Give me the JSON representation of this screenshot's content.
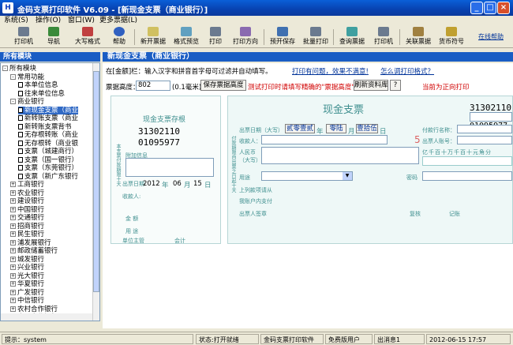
{
  "window": {
    "title": "金码支票打印软件  V6.09  - [新现金支票（商业银行）]",
    "min": "_",
    "max": "□",
    "close": "×"
  },
  "menu": [
    "系统(S)",
    "操作(O)",
    "窗口(W)",
    "更多票据(L)"
  ],
  "toolbar": [
    "打印机",
    "导航",
    "大写格式",
    "帮助",
    "新开票据",
    "格式预览",
    "打印",
    "打印方向",
    "预开保存",
    "批量打印",
    "查询票据",
    "打印机",
    "关联票据",
    "货币符号"
  ],
  "toolbar_link": "在线帮助",
  "sidebar": {
    "header": "所有模块",
    "tree": [
      {
        "t": "所有模块",
        "lv": 0,
        "k": "box",
        "s": "-"
      },
      {
        "t": "常用功能",
        "lv": 1,
        "k": "box",
        "s": "-"
      },
      {
        "t": "本单位信息",
        "lv": 2,
        "k": "pg"
      },
      {
        "t": "往来单位信息",
        "lv": 2,
        "k": "pg"
      },
      {
        "t": "商业银行",
        "lv": 1,
        "k": "box",
        "s": "-"
      },
      {
        "t": "新现金支票（商业",
        "lv": 2,
        "k": "pg",
        "sel": true
      },
      {
        "t": "新转账支票（商业",
        "lv": 2,
        "k": "pg"
      },
      {
        "t": "新转账支票背书",
        "lv": 2,
        "k": "pg"
      },
      {
        "t": "无存根转账（商业",
        "lv": 2,
        "k": "pg"
      },
      {
        "t": "无存根转（商业银",
        "lv": 2,
        "k": "pg"
      },
      {
        "t": "支票（城建商行）",
        "lv": 2,
        "k": "pg"
      },
      {
        "t": "支票（国一银行）",
        "lv": 2,
        "k": "pg"
      },
      {
        "t": "支票（东莞银行）",
        "lv": 2,
        "k": "pg"
      },
      {
        "t": "支票（新广东银行",
        "lv": 2,
        "k": "pg"
      },
      {
        "t": "工商银行",
        "lv": 1,
        "k": "box",
        "s": "+"
      },
      {
        "t": "农业银行",
        "lv": 1,
        "k": "box",
        "s": "+"
      },
      {
        "t": "建设银行",
        "lv": 1,
        "k": "box",
        "s": "+"
      },
      {
        "t": "中国银行",
        "lv": 1,
        "k": "box",
        "s": "+"
      },
      {
        "t": "交通银行",
        "lv": 1,
        "k": "box",
        "s": "+"
      },
      {
        "t": "招商银行",
        "lv": 1,
        "k": "box",
        "s": "+"
      },
      {
        "t": "民生银行",
        "lv": 1,
        "k": "box",
        "s": "+"
      },
      {
        "t": "浦发展银行",
        "lv": 1,
        "k": "box",
        "s": "+"
      },
      {
        "t": "邮政储蓄银行",
        "lv": 1,
        "k": "box",
        "s": "+"
      },
      {
        "t": "城发银行",
        "lv": 1,
        "k": "box",
        "s": "+"
      },
      {
        "t": "兴业银行",
        "lv": 1,
        "k": "box",
        "s": "+"
      },
      {
        "t": "光大银行",
        "lv": 1,
        "k": "box",
        "s": "+"
      },
      {
        "t": "华夏银行",
        "lv": 1,
        "k": "box",
        "s": "+"
      },
      {
        "t": "广发银行",
        "lv": 1,
        "k": "box",
        "s": "+"
      },
      {
        "t": "中信银行",
        "lv": 1,
        "k": "box",
        "s": "+"
      },
      {
        "t": "农村合作银行",
        "lv": 1,
        "k": "box",
        "s": "+"
      },
      {
        "t": "广州商业银行",
        "lv": 1,
        "k": "box",
        "s": "+"
      }
    ]
  },
  "main": {
    "header": "新现金支票（商业银行）",
    "hint": "在[金额]栏：输入汉字和拼音首字母可过滤并自动填写。",
    "link1": "打印有问题，效果不满意!",
    "link2": "怎么调打印格式？",
    "height_label": "票据高度：",
    "height_value": "802",
    "unit": "(0.1毫米)",
    "save_btn": "保存票据高度",
    "warn": "测试打印时请填写精确的\"票据高度\"！",
    "refresh_btn": "刷新资料库",
    "q_btn": "?",
    "right_note": "当前为正向打印"
  },
  "stub": {
    "title": "现金支票存根",
    "code1": "31302110",
    "code2": "01095977",
    "extra": "附加信息",
    "date_label": "出票日期",
    "year": "2012",
    "month": "06",
    "day": "15",
    "y": "年",
    "m": "月",
    "d": "日",
    "payee": "收款人:",
    "amount": "金  额",
    "purpose": "用  途",
    "manager": "单位主管",
    "acct": "会计",
    "side": "本支票付款期限十天"
  },
  "check": {
    "title": "现金支票",
    "code1": "31302110",
    "code2": "01095977",
    "date_label": "出票日期（大写）",
    "btn1": "贰零壹贰",
    "btn2": "零陆",
    "btn3": "壹拾伍",
    "year": "年",
    "month": "月",
    "day": "日",
    "bank_label": "付款行名称：",
    "acct_label": "出票人账号：",
    "payee": "收款人：",
    "rmb": "人民币",
    "rmb2": "（大写）",
    "digits": "亿千百十万千百十元角分",
    "purpose": "用途",
    "pwd": "密码",
    "line1": "上列款项请从",
    "line2": "我账户内支付",
    "signer": "出票人签章",
    "review": "复核",
    "bookkeep": "记账",
    "side": "付款期限自出票之日起十天",
    "num": "5"
  },
  "status": {
    "user": "提示：system",
    "state": "状态:打开就绪",
    "app": "金码支票打印软件",
    "free": "免费版用户",
    "msg": "出消息1",
    "date": "2012-06-15 17:57"
  }
}
